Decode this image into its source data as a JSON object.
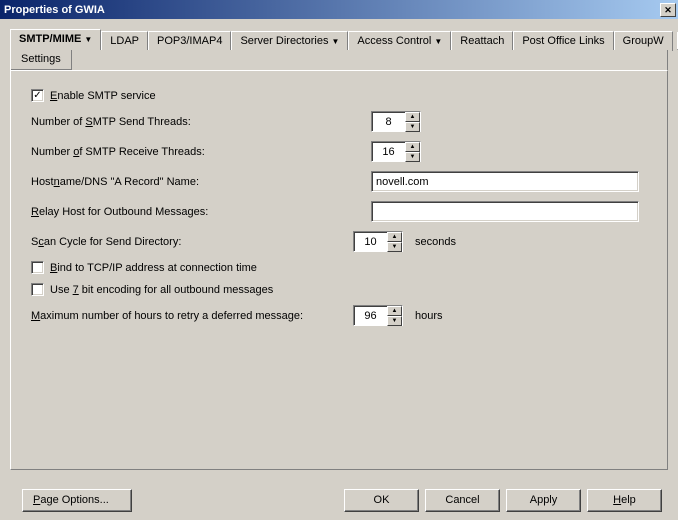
{
  "window": {
    "title": "Properties of GWIA"
  },
  "tabs": {
    "items": [
      {
        "label": "SMTP/MIME",
        "dropdown": true,
        "active": true
      },
      {
        "label": "LDAP"
      },
      {
        "label": "POP3/IMAP4"
      },
      {
        "label": "Server Directories",
        "dropdown": true
      },
      {
        "label": "Access Control",
        "dropdown": true
      },
      {
        "label": "Reattach"
      },
      {
        "label": "Post Office Links"
      },
      {
        "label": "GroupW"
      }
    ],
    "subtab": "Settings"
  },
  "form": {
    "enable_smtp": {
      "label_pre": "E",
      "label_post": "nable SMTP service",
      "checked": true
    },
    "send_threads": {
      "label_pre": "Number of ",
      "label_u": "S",
      "label_post": "MTP Send Threads:",
      "value": "8"
    },
    "recv_threads": {
      "label_pre": "Number ",
      "label_u": "o",
      "label_post": "f SMTP Receive Threads:",
      "value": "16"
    },
    "hostname": {
      "label_pre": "Host",
      "label_u": "n",
      "label_post": "ame/DNS \"A Record\" Name:",
      "value": "novell.com"
    },
    "relay_host": {
      "label_pre": "",
      "label_u": "R",
      "label_post": "elay Host for Outbound Messages:",
      "value": ""
    },
    "scan_cycle": {
      "label_pre": "S",
      "label_u": "c",
      "label_post": "an Cycle for Send Directory:",
      "value": "10",
      "suffix": "seconds"
    },
    "bind_tcpip": {
      "label_pre": "",
      "label_u": "B",
      "label_post": "ind to TCP/IP address at connection time",
      "checked": false
    },
    "seven_bit": {
      "label_pre": "Use ",
      "label_u": "7",
      "label_post": " bit encoding for all outbound messages",
      "checked": false
    },
    "max_retry": {
      "label_pre": "",
      "label_u": "M",
      "label_post": "aximum number of hours to retry a deferred message:",
      "value": "96",
      "suffix": "hours"
    }
  },
  "buttons": {
    "page_options": "Page Options...",
    "ok": "OK",
    "cancel": "Cancel",
    "apply": "Apply",
    "help": "Help",
    "page_options_u": "P",
    "help_u": "H"
  }
}
